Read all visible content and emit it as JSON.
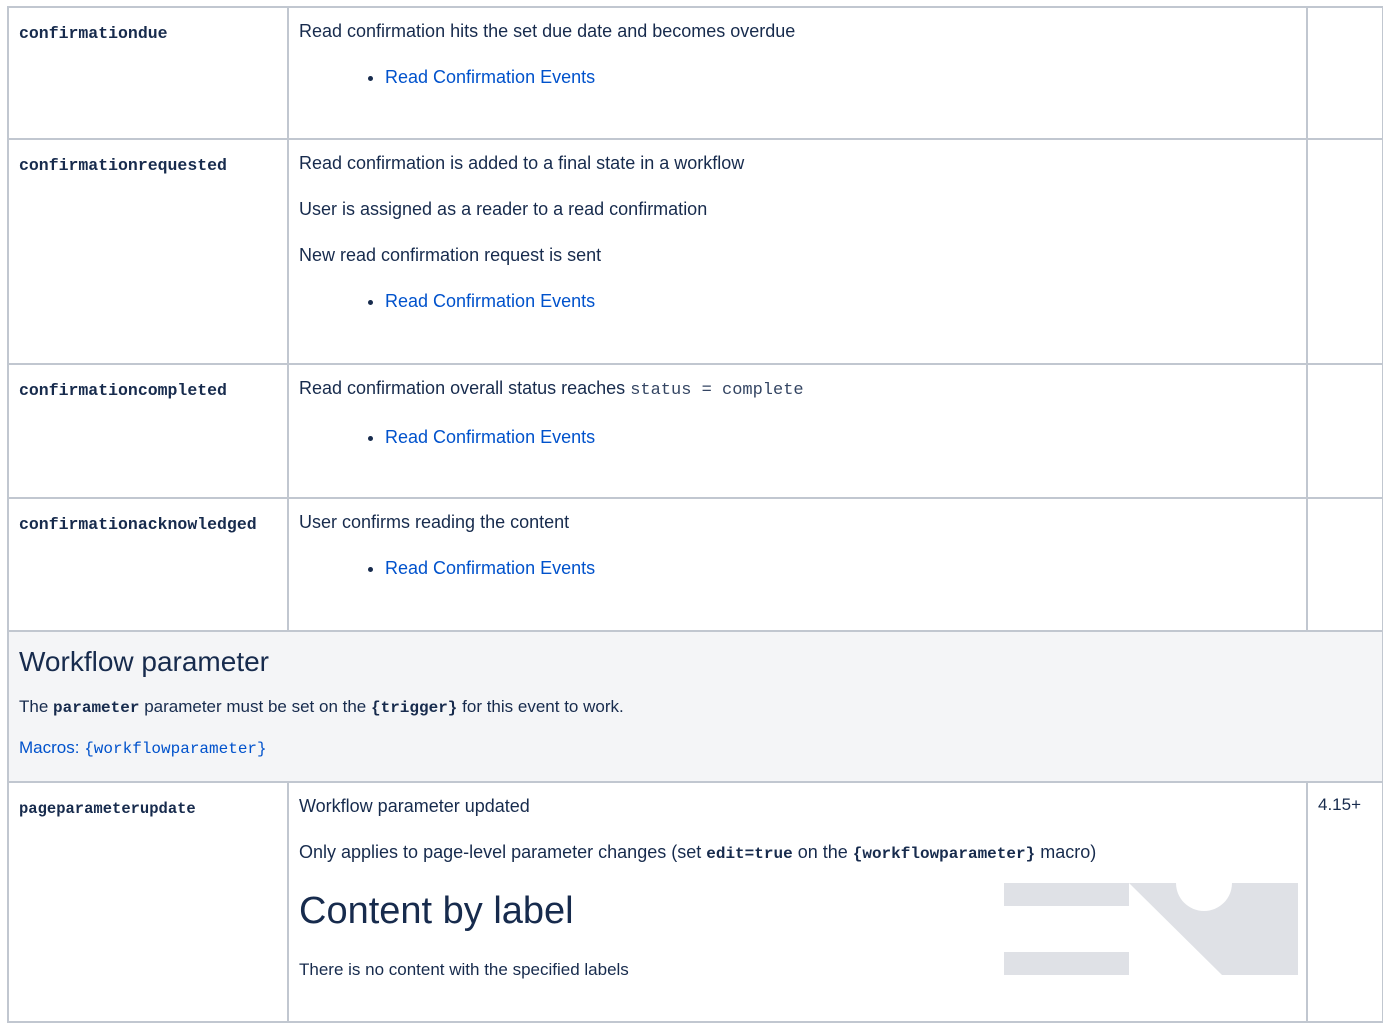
{
  "rows": [
    {
      "key": "confirmationdue",
      "lines": [
        "Read confirmation hits the set due date and becomes overdue"
      ],
      "link": "Read Confirmation Events"
    },
    {
      "key": "confirmationrequested",
      "lines": [
        "Read confirmation is added to a final state in a workflow",
        "User is assigned as a reader to a read confirmation",
        "New read confirmation request is sent"
      ],
      "link": "Read Confirmation Events"
    },
    {
      "key": "confirmationcompleted",
      "line_prefix": "Read confirmation overall status reaches",
      "line_code": "status = complete",
      "link": "Read Confirmation Events"
    },
    {
      "key": "confirmationacknowledged",
      "lines": [
        "User confirms reading the content"
      ],
      "link": "Read Confirmation Events"
    }
  ],
  "section": {
    "title": "Workflow parameter",
    "note_prefix": "The",
    "note_param": "parameter",
    "note_mid": "parameter must be set on the",
    "note_trigger": "{trigger}",
    "note_suffix": "for this event to work.",
    "macros_label": "Macros:",
    "macros_value": "{workflowparameter}"
  },
  "last_row": {
    "key": "pageparameterupdate",
    "line1": "Workflow parameter updated",
    "line2_prefix": "Only applies to page-level parameter changes (set",
    "line2_code": "edit=true",
    "line2_mid": "on the",
    "line2_macro": "{workflowparameter}",
    "line2_suffix": "macro)",
    "cbl_title": "Content by label",
    "cbl_note": "There is no content with the specified labels",
    "version": "4.15+"
  }
}
